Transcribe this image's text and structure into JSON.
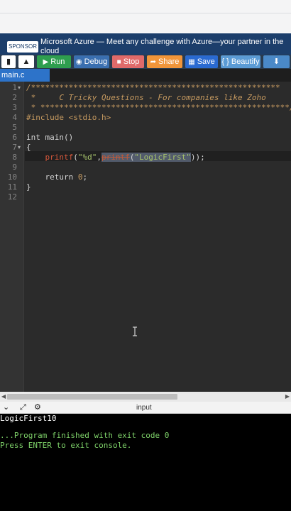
{
  "sponsor": {
    "tag": "SPONSOR",
    "text": "Microsoft Azure — Meet any challenge with Azure—your partner in the cloud"
  },
  "toolbar": {
    "run": "Run",
    "debug": "Debug",
    "stop": "Stop",
    "share": "Share",
    "save": "Save",
    "beautify": "{ } Beautify"
  },
  "tab": {
    "label": "main.c"
  },
  "editor": {
    "line_numbers": [
      "1",
      "2",
      "3",
      "4",
      "5",
      "6",
      "7",
      "8",
      "9",
      "10",
      "11",
      "12"
    ],
    "line1": "/*****************************************************",
    "line2": " *     C Tricky Questions - For companies like Zoho",
    "line3": " * *****************************************************/",
    "line4": "#include <stdio.h>",
    "line6": "int main()",
    "line7": "{",
    "line8_pre": "    ",
    "line8_fn": "printf",
    "line8_open": "(",
    "line8_fmt": "\"%d\"",
    "line8_comma": ",",
    "line8_inner": "printf",
    "line8_paren": "(",
    "line8_arg": "\"LogicFirst\"",
    "line8_close": "));",
    "line10_kw": "return",
    "line10_num": "0",
    "line10_end": ";",
    "line11": "}"
  },
  "io": {
    "title": "input"
  },
  "console": {
    "output": "LogicFirst10",
    "finished": "...Program finished with exit code 0",
    "prompt": "Press ENTER to exit console."
  }
}
